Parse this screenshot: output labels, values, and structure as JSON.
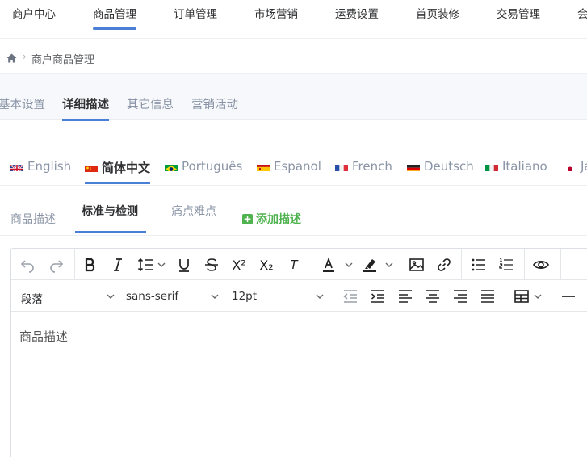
{
  "topnav": {
    "items": [
      {
        "label": "商户中心"
      },
      {
        "label": "商品管理",
        "active": true
      },
      {
        "label": "订单管理"
      },
      {
        "label": "市场营销"
      },
      {
        "label": "运费设置"
      },
      {
        "label": "首页装修"
      },
      {
        "label": "交易管理"
      },
      {
        "label": "会"
      }
    ]
  },
  "breadcrumb": {
    "separator": "›",
    "current": "商户商品管理"
  },
  "settings_tabs": [
    {
      "label": "基本设置"
    },
    {
      "label": "详细描述",
      "active": true
    },
    {
      "label": "其它信息"
    },
    {
      "label": "营销活动"
    }
  ],
  "languages": [
    {
      "label": "English",
      "flag": "uk"
    },
    {
      "label": "简体中文",
      "flag": "cn",
      "active": true
    },
    {
      "label": "Português",
      "flag": "br"
    },
    {
      "label": "Espanol",
      "flag": "es"
    },
    {
      "label": "French",
      "flag": "fr"
    },
    {
      "label": "Deutsch",
      "flag": "de"
    },
    {
      "label": "Italiano",
      "flag": "it"
    },
    {
      "label": "Ja",
      "flag": "jp"
    }
  ],
  "desc_tabs": [
    {
      "label": "商品描述"
    },
    {
      "label": "标准与检测",
      "active": true
    },
    {
      "label": "痛点难点"
    }
  ],
  "add_desc_label": "添加描述",
  "add_desc_icon": "+",
  "editor": {
    "block_format": "段落",
    "font_family": "sans-serif",
    "font_size": "12pt",
    "content": "商品描述",
    "superscript_label": "X²",
    "subscript_label": "X₂",
    "clear_format_label": "T"
  },
  "colors": {
    "accent": "#4a7fd6",
    "add": "#4fb34f",
    "muted": "#8a94a6"
  }
}
